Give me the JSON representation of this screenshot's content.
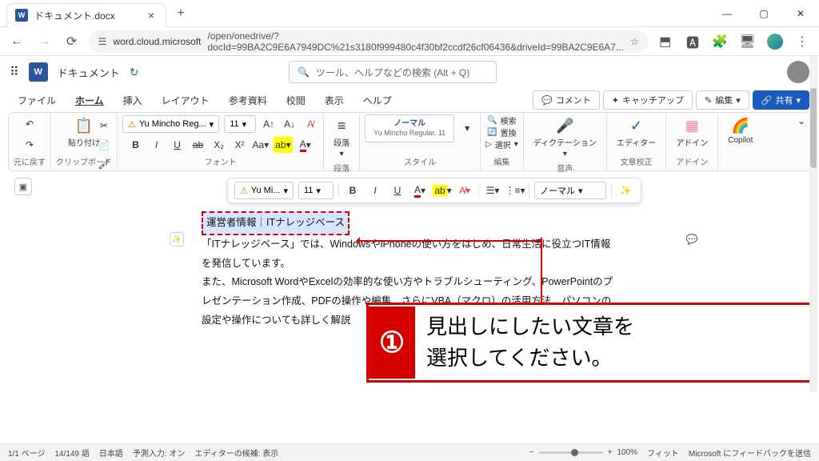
{
  "browser": {
    "tab_title": "ドキュメント.docx",
    "url_domain": "word.cloud.microsoft",
    "url_path": "/open/onedrive/?docId=99BA2C9E6A7949DC%21s3180f999480c4f30bf2ccdf26cf06436&driveId=99BA2C9E6A7..."
  },
  "app": {
    "word_badge": "W",
    "doc_name": "ドキュメント",
    "search_placeholder": "ツール、ヘルプなどの検索 (Alt + Q)"
  },
  "ribbon_tabs": {
    "file": "ファイル",
    "home": "ホーム",
    "insert": "挿入",
    "layout": "レイアウト",
    "references": "参考資料",
    "review": "校閲",
    "view": "表示",
    "help": "ヘルプ"
  },
  "actions": {
    "comments": "コメント",
    "catchup": "キャッチアップ",
    "editing": "編集",
    "share": "共有"
  },
  "groups": {
    "undo": "元に戻す",
    "clipboard": "クリップボード",
    "font": "フォント",
    "paragraph": "段落",
    "styles": "スタイル",
    "editing": "編集",
    "voice": "音声",
    "proofing": "文章校正",
    "addins": "アドイン"
  },
  "ribbon": {
    "paste": "貼り付け",
    "font_name": "Yu Mincho Reg...",
    "font_size": "11",
    "paragraph_btn": "段落",
    "style_normal": "ノーマル",
    "style_normal_sub": "Yu Mincho Regular, 11",
    "find": "検索",
    "replace": "置換",
    "select": "選択",
    "dictation": "ディクテーション",
    "editor": "エディター",
    "addin": "アドイン",
    "copilot": "Copilot"
  },
  "minitoolbar": {
    "font": "Yu Mi...",
    "size": "11",
    "style": "ノーマル"
  },
  "document": {
    "heading": "運営者情報｜ITナレッジベース",
    "para1": "「ITナレッジベース」では、WindowsやiPhoneの使い方をはじめ、日常生活に役立つIT情報を発信しています。",
    "para2": "また、Microsoft WordやExcelの効率的な使い方やトラブルシューティング、PowerPointのプレゼンテーション作成、PDFの操作や編集、さらにVBA（マクロ）の活用方法、パソコンの設定や操作についても詳しく解説"
  },
  "annotation": {
    "number": "①",
    "line1": "見出しにしたい文章を",
    "line2": "選択してください。"
  },
  "status": {
    "page": "1/1 ページ",
    "words": "14/149 語",
    "lang": "日本語",
    "predictive": "予測入力: オン",
    "editor_suggest": "エディターの候補: 表示",
    "zoom": "100%",
    "fit": "フィット",
    "feedback": "Microsoft にフィードバックを送信"
  }
}
